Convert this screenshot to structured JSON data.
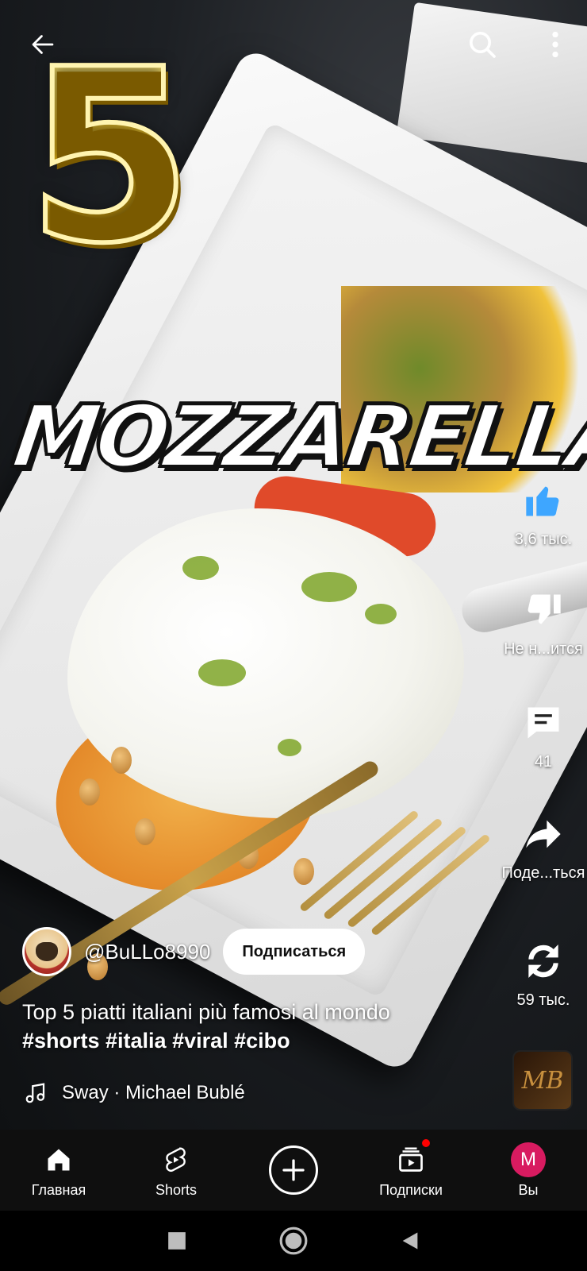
{
  "video": {
    "overlay_number": "5",
    "overlay_title": "MOZZARELLA"
  },
  "topbar": {
    "back_icon": "arrow-left-icon",
    "search_icon": "search-icon",
    "more_icon": "more-vert-icon"
  },
  "actions": {
    "like_count": "3,6 тыс.",
    "dislike_label": "Не н...ится",
    "comments_count": "41",
    "share_label": "Поде...ться",
    "remix_count": "59 тыс."
  },
  "channel": {
    "handle": "@BuLLo8990",
    "subscribe_label": "Подписаться"
  },
  "caption": {
    "text": "Top 5 piatti italiani più famosi al mondo",
    "hashtags": "#shorts #italia #viral #cibo"
  },
  "music": {
    "track": "Sway · Michael Bublé",
    "thumb_text": "MB"
  },
  "bottom_nav": {
    "home": "Главная",
    "shorts": "Shorts",
    "subscriptions": "Подписки",
    "you": "Вы",
    "you_initial": "M"
  },
  "colors": {
    "accent_red": "#ff0000",
    "like_blue": "#3ea6ff",
    "avatar_pink": "#d81b60",
    "nav_bg": "#0f0f0f"
  }
}
